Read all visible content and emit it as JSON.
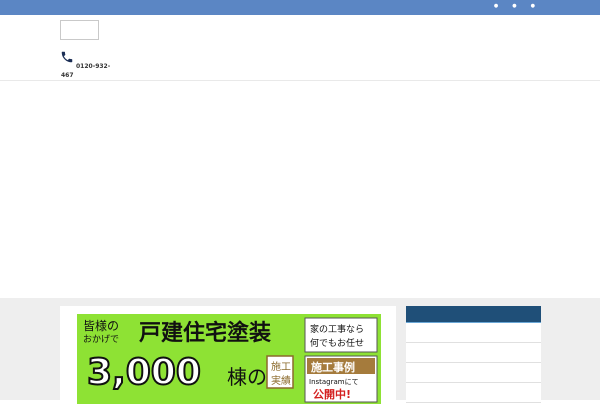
{
  "topbar": {
    "title": "",
    "nav": [
      {
        "label": ""
      },
      {
        "label": ""
      },
      {
        "label": ""
      }
    ]
  },
  "header": {
    "phone": "0120-932-467"
  },
  "banner": {
    "lines": [
      "皆様の",
      "おかげで",
      "戸建住宅塗装",
      "3,000",
      "棟の",
      "施工",
      "実績",
      "家の工事なら",
      "何でもお任せ",
      "施工事例",
      "Instagramにて",
      "公開中!"
    ]
  },
  "sidebar": {
    "title": "",
    "items": [
      {
        "label": ""
      },
      {
        "label": ""
      },
      {
        "label": ""
      },
      {
        "label": ""
      }
    ]
  },
  "colors": {
    "topbar": "#5b86c4",
    "sidebar_header": "#1f4f78",
    "banner_green": "#8ee234",
    "background": "#eeeeee"
  }
}
